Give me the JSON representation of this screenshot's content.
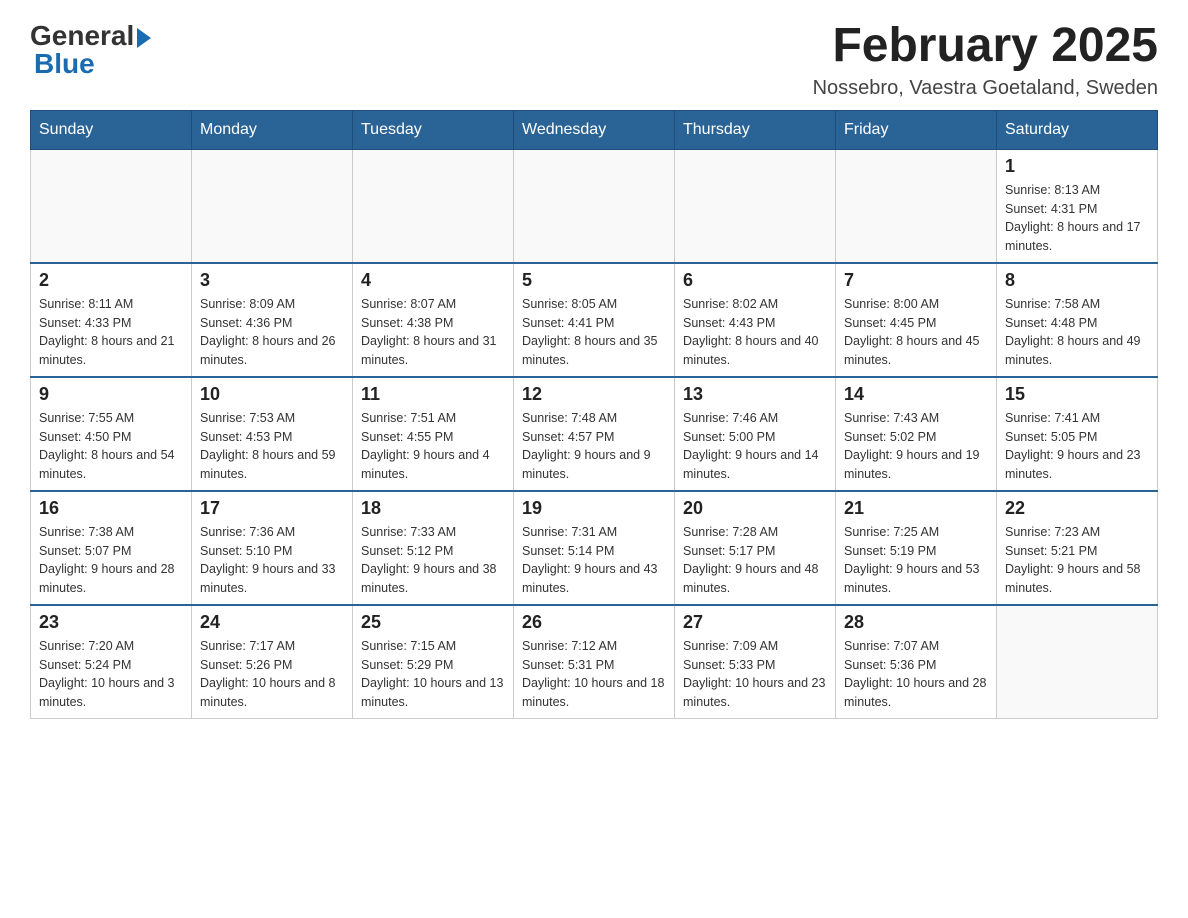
{
  "header": {
    "logo_general": "General",
    "logo_blue": "Blue",
    "month_title": "February 2025",
    "location": "Nossebro, Vaestra Goetaland, Sweden"
  },
  "weekdays": [
    "Sunday",
    "Monday",
    "Tuesday",
    "Wednesday",
    "Thursday",
    "Friday",
    "Saturday"
  ],
  "weeks": [
    [
      {
        "day": "",
        "sunrise": "",
        "sunset": "",
        "daylight": ""
      },
      {
        "day": "",
        "sunrise": "",
        "sunset": "",
        "daylight": ""
      },
      {
        "day": "",
        "sunrise": "",
        "sunset": "",
        "daylight": ""
      },
      {
        "day": "",
        "sunrise": "",
        "sunset": "",
        "daylight": ""
      },
      {
        "day": "",
        "sunrise": "",
        "sunset": "",
        "daylight": ""
      },
      {
        "day": "",
        "sunrise": "",
        "sunset": "",
        "daylight": ""
      },
      {
        "day": "1",
        "sunrise": "Sunrise: 8:13 AM",
        "sunset": "Sunset: 4:31 PM",
        "daylight": "Daylight: 8 hours and 17 minutes."
      }
    ],
    [
      {
        "day": "2",
        "sunrise": "Sunrise: 8:11 AM",
        "sunset": "Sunset: 4:33 PM",
        "daylight": "Daylight: 8 hours and 21 minutes."
      },
      {
        "day": "3",
        "sunrise": "Sunrise: 8:09 AM",
        "sunset": "Sunset: 4:36 PM",
        "daylight": "Daylight: 8 hours and 26 minutes."
      },
      {
        "day": "4",
        "sunrise": "Sunrise: 8:07 AM",
        "sunset": "Sunset: 4:38 PM",
        "daylight": "Daylight: 8 hours and 31 minutes."
      },
      {
        "day": "5",
        "sunrise": "Sunrise: 8:05 AM",
        "sunset": "Sunset: 4:41 PM",
        "daylight": "Daylight: 8 hours and 35 minutes."
      },
      {
        "day": "6",
        "sunrise": "Sunrise: 8:02 AM",
        "sunset": "Sunset: 4:43 PM",
        "daylight": "Daylight: 8 hours and 40 minutes."
      },
      {
        "day": "7",
        "sunrise": "Sunrise: 8:00 AM",
        "sunset": "Sunset: 4:45 PM",
        "daylight": "Daylight: 8 hours and 45 minutes."
      },
      {
        "day": "8",
        "sunrise": "Sunrise: 7:58 AM",
        "sunset": "Sunset: 4:48 PM",
        "daylight": "Daylight: 8 hours and 49 minutes."
      }
    ],
    [
      {
        "day": "9",
        "sunrise": "Sunrise: 7:55 AM",
        "sunset": "Sunset: 4:50 PM",
        "daylight": "Daylight: 8 hours and 54 minutes."
      },
      {
        "day": "10",
        "sunrise": "Sunrise: 7:53 AM",
        "sunset": "Sunset: 4:53 PM",
        "daylight": "Daylight: 8 hours and 59 minutes."
      },
      {
        "day": "11",
        "sunrise": "Sunrise: 7:51 AM",
        "sunset": "Sunset: 4:55 PM",
        "daylight": "Daylight: 9 hours and 4 minutes."
      },
      {
        "day": "12",
        "sunrise": "Sunrise: 7:48 AM",
        "sunset": "Sunset: 4:57 PM",
        "daylight": "Daylight: 9 hours and 9 minutes."
      },
      {
        "day": "13",
        "sunrise": "Sunrise: 7:46 AM",
        "sunset": "Sunset: 5:00 PM",
        "daylight": "Daylight: 9 hours and 14 minutes."
      },
      {
        "day": "14",
        "sunrise": "Sunrise: 7:43 AM",
        "sunset": "Sunset: 5:02 PM",
        "daylight": "Daylight: 9 hours and 19 minutes."
      },
      {
        "day": "15",
        "sunrise": "Sunrise: 7:41 AM",
        "sunset": "Sunset: 5:05 PM",
        "daylight": "Daylight: 9 hours and 23 minutes."
      }
    ],
    [
      {
        "day": "16",
        "sunrise": "Sunrise: 7:38 AM",
        "sunset": "Sunset: 5:07 PM",
        "daylight": "Daylight: 9 hours and 28 minutes."
      },
      {
        "day": "17",
        "sunrise": "Sunrise: 7:36 AM",
        "sunset": "Sunset: 5:10 PM",
        "daylight": "Daylight: 9 hours and 33 minutes."
      },
      {
        "day": "18",
        "sunrise": "Sunrise: 7:33 AM",
        "sunset": "Sunset: 5:12 PM",
        "daylight": "Daylight: 9 hours and 38 minutes."
      },
      {
        "day": "19",
        "sunrise": "Sunrise: 7:31 AM",
        "sunset": "Sunset: 5:14 PM",
        "daylight": "Daylight: 9 hours and 43 minutes."
      },
      {
        "day": "20",
        "sunrise": "Sunrise: 7:28 AM",
        "sunset": "Sunset: 5:17 PM",
        "daylight": "Daylight: 9 hours and 48 minutes."
      },
      {
        "day": "21",
        "sunrise": "Sunrise: 7:25 AM",
        "sunset": "Sunset: 5:19 PM",
        "daylight": "Daylight: 9 hours and 53 minutes."
      },
      {
        "day": "22",
        "sunrise": "Sunrise: 7:23 AM",
        "sunset": "Sunset: 5:21 PM",
        "daylight": "Daylight: 9 hours and 58 minutes."
      }
    ],
    [
      {
        "day": "23",
        "sunrise": "Sunrise: 7:20 AM",
        "sunset": "Sunset: 5:24 PM",
        "daylight": "Daylight: 10 hours and 3 minutes."
      },
      {
        "day": "24",
        "sunrise": "Sunrise: 7:17 AM",
        "sunset": "Sunset: 5:26 PM",
        "daylight": "Daylight: 10 hours and 8 minutes."
      },
      {
        "day": "25",
        "sunrise": "Sunrise: 7:15 AM",
        "sunset": "Sunset: 5:29 PM",
        "daylight": "Daylight: 10 hours and 13 minutes."
      },
      {
        "day": "26",
        "sunrise": "Sunrise: 7:12 AM",
        "sunset": "Sunset: 5:31 PM",
        "daylight": "Daylight: 10 hours and 18 minutes."
      },
      {
        "day": "27",
        "sunrise": "Sunrise: 7:09 AM",
        "sunset": "Sunset: 5:33 PM",
        "daylight": "Daylight: 10 hours and 23 minutes."
      },
      {
        "day": "28",
        "sunrise": "Sunrise: 7:07 AM",
        "sunset": "Sunset: 5:36 PM",
        "daylight": "Daylight: 10 hours and 28 minutes."
      },
      {
        "day": "",
        "sunrise": "",
        "sunset": "",
        "daylight": ""
      }
    ]
  ]
}
